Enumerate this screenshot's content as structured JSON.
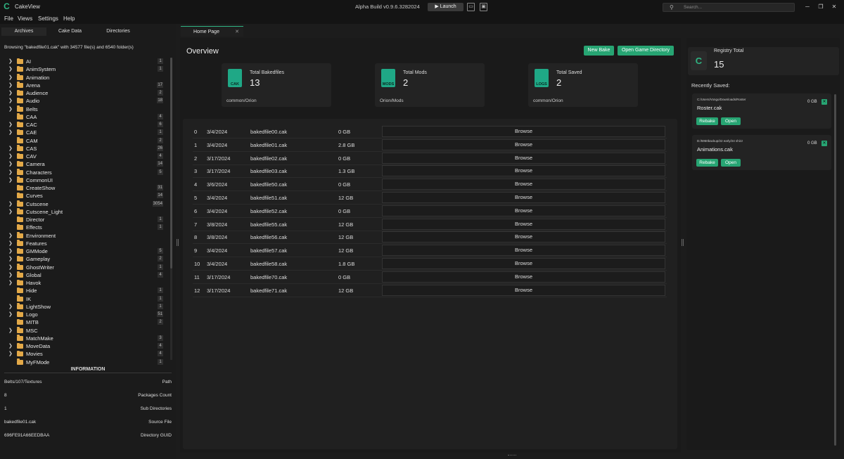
{
  "app": {
    "title": "CakeView",
    "build": "Alpha Build v0.9.6.3282024",
    "launch": "▶  Launch",
    "search_placeholder": "Search..."
  },
  "menu": [
    "File",
    "Views",
    "Settings",
    "Help"
  ],
  "sidebar": {
    "tabs": [
      "Archives",
      "Cake Data",
      "Directories"
    ],
    "browsing": "Browsing \"bakedfile01.cak\" with 34577 file(s) and 6540 folder(s)",
    "tree": [
      {
        "name": "AI",
        "count": "1",
        "expand": true
      },
      {
        "name": "AnimSystem",
        "count": "1",
        "expand": true
      },
      {
        "name": "Animation",
        "count": "",
        "expand": true
      },
      {
        "name": "Arena",
        "count": "17",
        "expand": true
      },
      {
        "name": "Audience",
        "count": "2",
        "expand": true
      },
      {
        "name": "Audio",
        "count": "18",
        "expand": true
      },
      {
        "name": "Belts",
        "count": "",
        "expand": true
      },
      {
        "name": "CAA",
        "count": "4",
        "expand": false
      },
      {
        "name": "CAC",
        "count": "6",
        "expand": true
      },
      {
        "name": "CAE",
        "count": "1",
        "expand": true
      },
      {
        "name": "CAM",
        "count": "2",
        "expand": false
      },
      {
        "name": "CAS",
        "count": "26",
        "expand": true
      },
      {
        "name": "CAV",
        "count": "4",
        "expand": true
      },
      {
        "name": "Camera",
        "count": "14",
        "expand": true
      },
      {
        "name": "Characters",
        "count": "5",
        "expand": true
      },
      {
        "name": "CommonUI",
        "count": "",
        "expand": true
      },
      {
        "name": "CreateShow",
        "count": "31",
        "expand": false
      },
      {
        "name": "Curves",
        "count": "14",
        "expand": false
      },
      {
        "name": "Cutscene",
        "count": "3054",
        "expand": true
      },
      {
        "name": "Cutscene_Light",
        "count": "",
        "expand": true
      },
      {
        "name": "Director",
        "count": "1",
        "expand": false
      },
      {
        "name": "Effects",
        "count": "1",
        "expand": false
      },
      {
        "name": "Environment",
        "count": "",
        "expand": true
      },
      {
        "name": "Features",
        "count": "",
        "expand": true
      },
      {
        "name": "GMMode",
        "count": "5",
        "expand": true
      },
      {
        "name": "Gameplay",
        "count": "2",
        "expand": true
      },
      {
        "name": "GhostWriter",
        "count": "1",
        "expand": true
      },
      {
        "name": "Global",
        "count": "4",
        "expand": true
      },
      {
        "name": "Havok",
        "count": "",
        "expand": true
      },
      {
        "name": "Hide",
        "count": "1",
        "expand": false
      },
      {
        "name": "IK",
        "count": "1",
        "expand": false
      },
      {
        "name": "LightShow",
        "count": "1",
        "expand": true
      },
      {
        "name": "Logo",
        "count": "51",
        "expand": true
      },
      {
        "name": "MITB",
        "count": "2",
        "expand": false
      },
      {
        "name": "MSC",
        "count": "",
        "expand": true
      },
      {
        "name": "MatchMake",
        "count": "3",
        "expand": false
      },
      {
        "name": "MoveData",
        "count": "4",
        "expand": true
      },
      {
        "name": "Movies",
        "count": "4",
        "expand": true
      },
      {
        "name": "MyFMode",
        "count": "1",
        "expand": false
      }
    ],
    "info_title": "INFORMATION",
    "info": [
      {
        "value": "Belts/107/Textures",
        "key": "Path"
      },
      {
        "value": "8",
        "key": "Packages Count"
      },
      {
        "value": "1",
        "key": "Sub Directories"
      },
      {
        "value": "bakedfile01.cak",
        "key": "Source File"
      },
      {
        "value": "696FE91A66EEDBAA",
        "key": "Directory GUID"
      }
    ]
  },
  "main": {
    "tab": "Home Page",
    "overview": "Overview",
    "new_bake": "New Bake",
    "open_dir": "Open Game Directory",
    "stats": [
      {
        "title": "Total Bakedfiles",
        "value": "13",
        "path": "common/Orion",
        "icon": "CAK"
      },
      {
        "title": "Total Mods",
        "value": "2",
        "path": "Orion/Mods",
        "icon": "MODS"
      },
      {
        "title": "Total Saved",
        "value": "2",
        "path": "common/Orion",
        "icon": "LOGS"
      }
    ],
    "browse_label": "Browse",
    "rows": [
      {
        "i": "0",
        "date": "3/4/2024",
        "file": "bakedfile00.cak",
        "size": "0 GB"
      },
      {
        "i": "1",
        "date": "3/4/2024",
        "file": "bakedfile01.cak",
        "size": "2.8 GB"
      },
      {
        "i": "2",
        "date": "3/17/2024",
        "file": "bakedfile02.cak",
        "size": "0 GB"
      },
      {
        "i": "3",
        "date": "3/17/2024",
        "file": "bakedfile03.cak",
        "size": "1.3 GB"
      },
      {
        "i": "4",
        "date": "3/6/2024",
        "file": "bakedfile50.cak",
        "size": "0 GB"
      },
      {
        "i": "5",
        "date": "3/4/2024",
        "file": "bakedfile51.cak",
        "size": "12 GB"
      },
      {
        "i": "6",
        "date": "3/4/2024",
        "file": "bakedfile52.cak",
        "size": "0 GB"
      },
      {
        "i": "7",
        "date": "3/8/2024",
        "file": "bakedfile55.cak",
        "size": "12 GB"
      },
      {
        "i": "8",
        "date": "3/8/2024",
        "file": "bakedfile56.cak",
        "size": "12 GB"
      },
      {
        "i": "9",
        "date": "3/4/2024",
        "file": "bakedfile57.cak",
        "size": "12 GB"
      },
      {
        "i": "10",
        "date": "3/4/2024",
        "file": "bakedfile58.cak",
        "size": "1.8 GB"
      },
      {
        "i": "11",
        "date": "3/17/2024",
        "file": "bakedfile70.cak",
        "size": "0 GB"
      },
      {
        "i": "12",
        "date": "3/17/2024",
        "file": "bakedfile71.cak",
        "size": "12 GB"
      }
    ]
  },
  "registry": {
    "label": "Registry Total",
    "value": "15"
  },
  "recent": {
    "label": "Recently Saved:",
    "rebake": "Rebake",
    "open": "Open",
    "items": [
      {
        "path": "C:/Users/Vongo/Downloads/Roster",
        "name": "Roster.cak",
        "size": "0 GB"
      },
      {
        "path": "D:/5950backup/22 early/24 shizz",
        "name": "Animations.cak",
        "size": "0 GB"
      }
    ]
  }
}
